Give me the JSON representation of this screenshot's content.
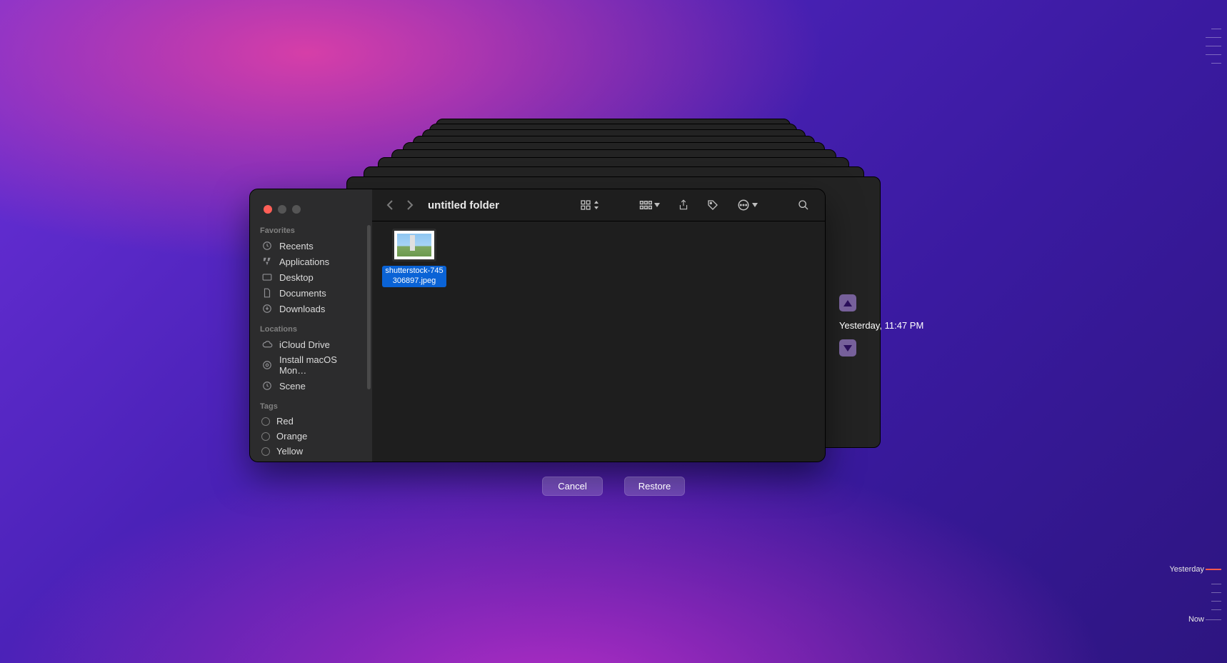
{
  "window": {
    "title": "untitled folder"
  },
  "sidebar": {
    "sections": {
      "favorites": {
        "header": "Favorites",
        "items": [
          "Recents",
          "Applications",
          "Desktop",
          "Documents",
          "Downloads"
        ]
      },
      "locations": {
        "header": "Locations",
        "items": [
          "iCloud Drive",
          "Install macOS Mon…",
          "Scene"
        ]
      },
      "tags": {
        "header": "Tags",
        "items": [
          "Red",
          "Orange",
          "Yellow"
        ]
      }
    }
  },
  "file": {
    "name_line1": "shutterstock-745",
    "name_line2": "306897.jpeg"
  },
  "timemachine": {
    "timestamp": "Yesterday, 11:47 PM"
  },
  "buttons": {
    "cancel": "Cancel",
    "restore": "Restore"
  },
  "timeline": {
    "yesterday": "Yesterday",
    "now": "Now"
  }
}
